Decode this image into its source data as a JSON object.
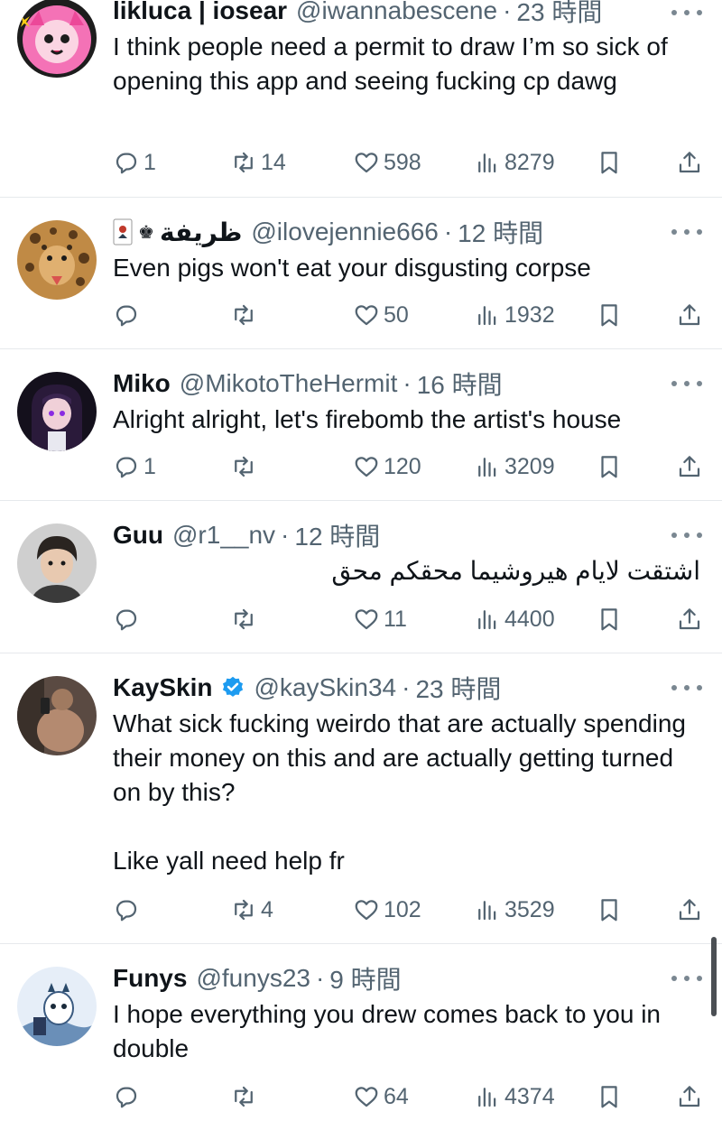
{
  "posts": [
    {
      "name": "likluca | iosear",
      "handle": "@iwannabescene",
      "sep": "·",
      "time": "23 時間",
      "text": "I think people need a permit to draw I’m so sick of opening this app and seeing fucking cp dawg",
      "reply_count": "1",
      "repost_count": "14",
      "like_count": "598",
      "view_count": "8279",
      "avatar_color": "#f472b6"
    },
    {
      "name": "ظريفة",
      "name_prefix_icon": "joker-card-icon",
      "name_chess": "♚",
      "handle": "@ilovejennie666",
      "sep": "·",
      "time": "12 時間",
      "text": "Even pigs won't eat your disgusting corpse",
      "reply_count": "",
      "repost_count": "",
      "like_count": "50",
      "view_count": "1932",
      "avatar_color": "#b07a3a"
    },
    {
      "name": "Miko",
      "handle": "@MikotoTheHermit",
      "sep": "·",
      "time": "16 時間",
      "text": "Alright alright, let's firebomb the artist's house",
      "reply_count": "1",
      "repost_count": "",
      "like_count": "120",
      "view_count": "3209",
      "avatar_color": "#2a1a3a"
    },
    {
      "name": "Guu",
      "handle": "@r1__nv",
      "sep": "·",
      "time": "12 時間",
      "text": "اشتقت لايام هيروشيما محقكم محق",
      "reply_count": "",
      "repost_count": "",
      "like_count": "11",
      "view_count": "4400",
      "avatar_color": "#9a9a9a"
    },
    {
      "name": "KaySkin",
      "verified": true,
      "handle": "@kaySkin34",
      "sep": "·",
      "time": "23 時間",
      "text": "What sick fucking weirdo that are actually spending their money on this and are actually getting turned on by this?\n\nLike yall need help fr",
      "reply_count": "",
      "repost_count": "4",
      "like_count": "102",
      "view_count": "3529",
      "avatar_color": "#8a6a55"
    },
    {
      "name": "Funys",
      "handle": "@funys23",
      "sep": "·",
      "time": "9 時間",
      "text": "I hope everything you drew comes back to you in double",
      "reply_count": "",
      "repost_count": "",
      "like_count": "64",
      "view_count": "4374",
      "avatar_color": "#6a8fb8"
    }
  ],
  "colors": {
    "text": "#0f1419",
    "secondary": "#536471",
    "divider": "#e6e9ec",
    "verified": "#1d9bf0"
  }
}
